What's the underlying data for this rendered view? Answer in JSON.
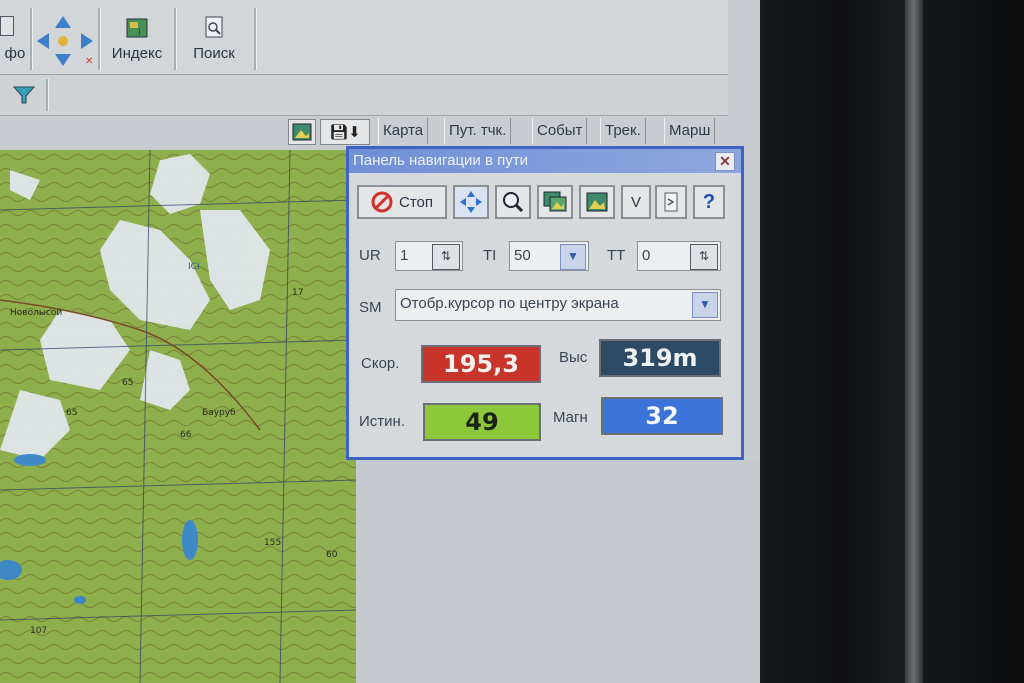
{
  "toolbar": {
    "info_label": "фо",
    "index_label": "Индекс",
    "search_label": "Поиск"
  },
  "tabs": [
    "Карта",
    "Пут. тчк.",
    "Событ",
    "Трек.",
    "Марш"
  ],
  "map": {
    "labels": [
      "Новолысой",
      "65",
      "65",
      "66",
      "Бауруб",
      "155",
      "107",
      "17",
      "ICI",
      "60"
    ]
  },
  "nav_panel": {
    "title": "Панель навигации в пути",
    "close_glyph": "✕",
    "stop_label": "Стоп",
    "v_label": "V",
    "help_label": "?",
    "ur": {
      "label": "UR",
      "value": "1"
    },
    "ti": {
      "label": "TI",
      "value": "50"
    },
    "tt": {
      "label": "TT",
      "value": "0"
    },
    "sm": {
      "label": "SM",
      "value": "Отобр.курсор по центру экрана"
    },
    "speed": {
      "label": "Скор.",
      "value": "195,3"
    },
    "altitude": {
      "label": "Выс",
      "value": "319m"
    },
    "true_heading": {
      "label": "Истин.",
      "value": "49"
    },
    "magnetic_heading": {
      "label": "Магн",
      "value": "32"
    }
  },
  "colors": {
    "speed_bg": "#c8342a",
    "altitude_bg": "#2c4a64",
    "true_bg": "#8cc83a",
    "magnetic_bg": "#3b73d8",
    "panel_border": "#3d63c4"
  }
}
